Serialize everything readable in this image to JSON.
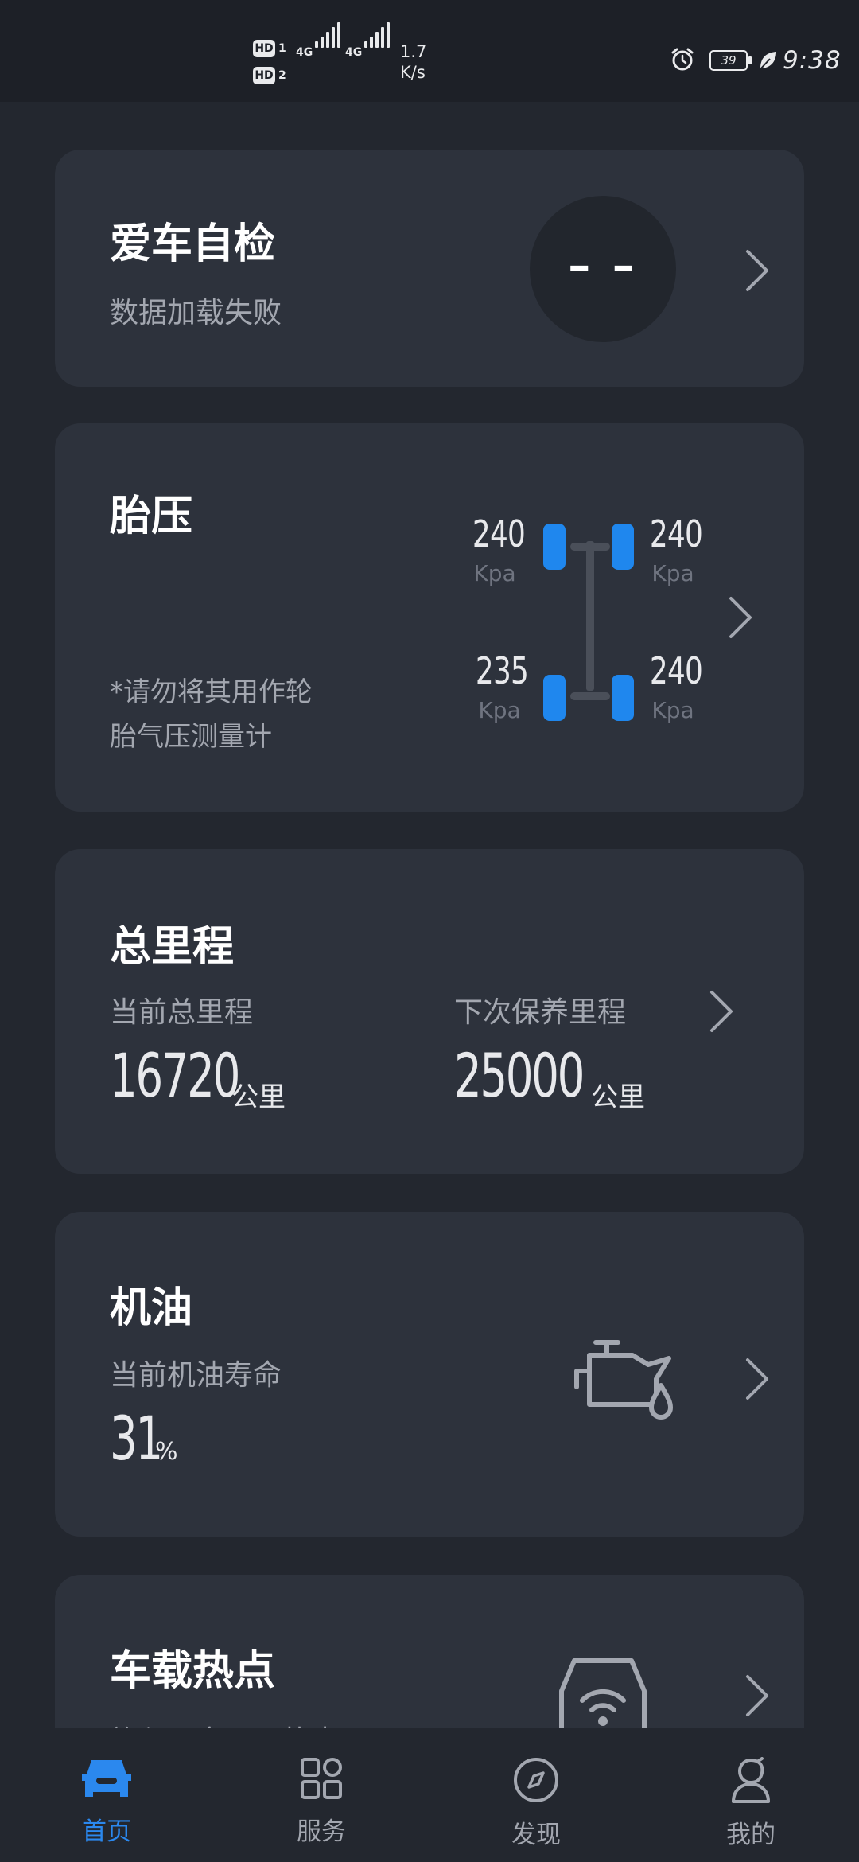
{
  "status_bar": {
    "sim1_label": "HD",
    "sim1_num": "1",
    "sim2_label": "HD",
    "sim2_num": "2",
    "network1": "4G",
    "network2": "4G",
    "speed_value": "1.7",
    "speed_unit": "K/s",
    "battery": "39",
    "time": "9:38"
  },
  "self_check": {
    "title": "爱车自检",
    "status": "数据加载失败",
    "score": "– –"
  },
  "tire": {
    "title": "胎压",
    "warning_line1": "*请勿将其用作轮",
    "warning_line2": "胎气压测量计",
    "unit": "Kpa",
    "front_left": "240",
    "front_right": "240",
    "rear_left": "235",
    "rear_right": "240"
  },
  "mileage": {
    "title": "总里程",
    "current_label": "当前总里程",
    "current_value": "16720",
    "next_label": "下次保养里程",
    "next_value": "25000",
    "unit": "公里"
  },
  "oil": {
    "title": "机油",
    "label": "当前机油寿命",
    "value": "31",
    "unit": "%"
  },
  "hotspot": {
    "title": "车载热点",
    "subtitle": "旅程尽享WiFi热点"
  },
  "nav": {
    "items": [
      {
        "label": "首页",
        "icon": "car-icon",
        "active": true
      },
      {
        "label": "服务",
        "icon": "grid-icon",
        "active": false
      },
      {
        "label": "发现",
        "icon": "compass-icon",
        "active": false
      },
      {
        "label": "我的",
        "icon": "person-icon",
        "active": false
      }
    ]
  },
  "colors": {
    "background": "#23272f",
    "card": "#2d323c",
    "accent": "#1f87ee",
    "text_secondary": "#a3a7b0"
  }
}
